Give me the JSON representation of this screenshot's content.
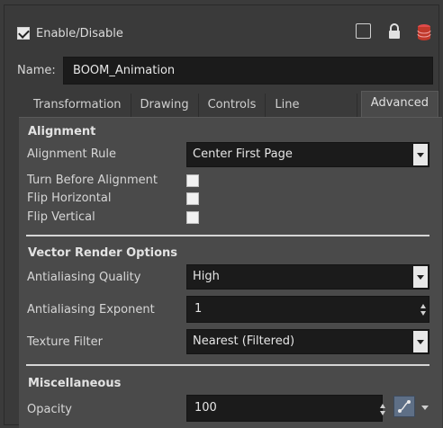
{
  "header": {
    "enable_label": "Enable/Disable",
    "enabled": true
  },
  "name_row": {
    "label": "Name:",
    "value": "BOOM_Animation"
  },
  "tabs": [
    {
      "label": "Transformation"
    },
    {
      "label": "Drawing"
    },
    {
      "label": "Controls"
    },
    {
      "label": "Line Thickness"
    },
    {
      "label": "Advanced",
      "active": true
    }
  ],
  "alignment": {
    "title": "Alignment",
    "rule_label": "Alignment Rule",
    "rule_value": "Center First Page",
    "turn_before_label": "Turn Before Alignment",
    "flip_h_label": "Flip Horizontal",
    "flip_v_label": "Flip Vertical"
  },
  "vector": {
    "title": "Vector Render Options",
    "aa_quality_label": "Antialiasing Quality",
    "aa_quality_value": "High",
    "aa_exponent_label": "Antialiasing Exponent",
    "aa_exponent_value": "1",
    "texture_label": "Texture Filter",
    "texture_value": "Nearest (Filtered)"
  },
  "misc": {
    "title": "Miscellaneous",
    "opacity_label": "Opacity",
    "opacity_value": "100"
  },
  "icons": {
    "square": "square-outline-icon",
    "lock": "lock-icon",
    "database": "database-icon",
    "function": "function-curve-icon"
  },
  "colors": {
    "accent_red": "#c0392b",
    "function_button": "#5e6f86"
  }
}
